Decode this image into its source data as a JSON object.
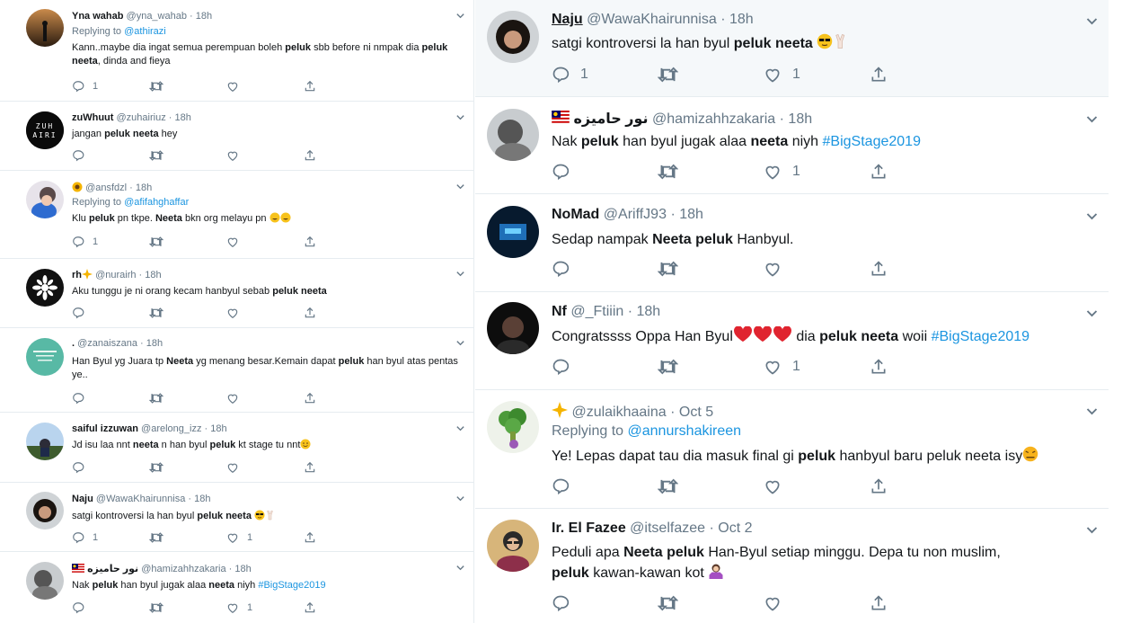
{
  "icons": {
    "reply": "reply-icon",
    "retweet": "retweet-icon",
    "like": "heart-icon",
    "share": "share-icon",
    "more": "chevron-down-icon"
  },
  "colors": {
    "text": "#14171a",
    "muted": "#657786",
    "link": "#1b95e0",
    "highlight": "#f5f8fa",
    "border": "#e6ecf0"
  },
  "left_panel": {
    "tweets": [
      {
        "name": "Yna wahab",
        "handle": "@yna_wahab",
        "sep": "·",
        "time": "18h",
        "replying_label": "Replying to",
        "replying_to": "@athirazi",
        "text": [
          {
            "t": "Kann..maybe dia ingat semua perempuan boleh "
          },
          {
            "t": "peluk",
            "b": true
          },
          {
            "t": " sbb before ni nmpak dia "
          },
          {
            "t": "peluk neeta",
            "b": true
          },
          {
            "t": ", dinda and fieya"
          }
        ],
        "counts": {
          "reply": "1",
          "retweet": "",
          "like": ""
        }
      },
      {
        "name": "zuWhuut",
        "handle": "@zuhairiuz",
        "sep": "·",
        "time": "18h",
        "avatar_text": "ZUH AIRI",
        "text": [
          {
            "t": "jangan "
          },
          {
            "t": "peluk neeta",
            "b": true
          },
          {
            "t": " hey"
          }
        ],
        "counts": {
          "reply": "",
          "retweet": "",
          "like": ""
        }
      },
      {
        "name": "",
        "handle": "@ansfdzl",
        "sep": "·",
        "time": "18h",
        "replying_label": "Replying to",
        "replying_to": "@afifahghaffar",
        "text": [
          {
            "t": "Klu "
          },
          {
            "t": "peluk",
            "b": true
          },
          {
            "t": " pn tkpe. "
          },
          {
            "t": "Neeta",
            "b": true
          },
          {
            "t": " bkn org melayu pn "
          }
        ],
        "counts": {
          "reply": "1",
          "retweet": "",
          "like": ""
        }
      },
      {
        "name": "rh",
        "handle": "@nurairh",
        "sep": "·",
        "time": "18h",
        "text": [
          {
            "t": "Aku tunggu je ni orang kecam hanbyul sebab "
          },
          {
            "t": "peluk neeta",
            "b": true
          }
        ],
        "counts": {
          "reply": "",
          "retweet": "",
          "like": ""
        }
      },
      {
        "name": ".",
        "handle": "@zanaiszana",
        "sep": "·",
        "time": "18h",
        "text": [
          {
            "t": "Han Byul yg Juara tp "
          },
          {
            "t": "Neeta",
            "b": true
          },
          {
            "t": " yg menang besar.Kemain dapat "
          },
          {
            "t": "peluk",
            "b": true
          },
          {
            "t": " han byul atas pentas ye.."
          }
        ],
        "counts": {
          "reply": "",
          "retweet": "",
          "like": ""
        }
      },
      {
        "name": "saiful izzuwan",
        "handle": "@arelong_izz",
        "sep": "·",
        "time": "18h",
        "text": [
          {
            "t": "Jd isu laa nnt "
          },
          {
            "t": "neeta",
            "b": true
          },
          {
            "t": " n han byul "
          },
          {
            "t": "peluk",
            "b": true
          },
          {
            "t": " kt stage tu nnt"
          }
        ],
        "counts": {
          "reply": "",
          "retweet": "",
          "like": ""
        }
      },
      {
        "name": "Naju",
        "handle": "@WawaKhairunnisa",
        "sep": "·",
        "time": "18h",
        "text": [
          {
            "t": "satgi kontroversi la han byul "
          },
          {
            "t": "peluk neeta",
            "b": true
          },
          {
            "t": " "
          }
        ],
        "counts": {
          "reply": "1",
          "retweet": "",
          "like": "1"
        }
      },
      {
        "name": "نور حامیزه",
        "handle": "@hamizahhzakaria",
        "sep": "·",
        "time": "18h",
        "text": [
          {
            "t": "Nak "
          },
          {
            "t": "peluk",
            "b": true
          },
          {
            "t": " han byul jugak alaa "
          },
          {
            "t": "neeta",
            "b": true
          },
          {
            "t": " niyh "
          },
          {
            "t": "#BigStage2019",
            "l": true
          }
        ],
        "counts": {
          "reply": "",
          "retweet": "",
          "like": "1"
        }
      }
    ]
  },
  "right_panel": {
    "tweets": [
      {
        "name": "Naju",
        "handle": "@WawaKhairunnisa",
        "sep": "·",
        "time": "18h",
        "text": [
          {
            "t": "satgi kontroversi la han byul "
          },
          {
            "t": "peluk neeta",
            "b": true
          },
          {
            "t": " "
          }
        ],
        "counts": {
          "reply": "1",
          "retweet": "",
          "like": "1"
        }
      },
      {
        "name": "نور حامیزه",
        "handle": "@hamizahhzakaria",
        "sep": "·",
        "time": "18h",
        "text": [
          {
            "t": "Nak "
          },
          {
            "t": "peluk",
            "b": true
          },
          {
            "t": " han byul jugak alaa "
          },
          {
            "t": "neeta",
            "b": true
          },
          {
            "t": " niyh "
          },
          {
            "t": "#BigStage2019",
            "l": true
          }
        ],
        "counts": {
          "reply": "",
          "retweet": "",
          "like": "1"
        }
      },
      {
        "name": "NoMad",
        "handle": "@AriffJ93",
        "sep": "·",
        "time": "18h",
        "text": [
          {
            "t": "Sedap nampak "
          },
          {
            "t": "Neeta peluk",
            "b": true
          },
          {
            "t": " Hanbyul."
          }
        ],
        "counts": {
          "reply": "",
          "retweet": "",
          "like": ""
        }
      },
      {
        "name": "Nf",
        "handle": "@_Ftiiin",
        "sep": "·",
        "time": "18h",
        "text": [
          {
            "t": "Congratssss Oppa Han Byul"
          },
          {
            "t": " dia "
          },
          {
            "t": "peluk neeta",
            "b": true
          },
          {
            "t": " woii "
          },
          {
            "t": "#BigStage2019",
            "l": true
          }
        ],
        "counts": {
          "reply": "",
          "retweet": "",
          "like": "1"
        }
      },
      {
        "name": "",
        "handle": "@zulaikhaaina",
        "sep": "·",
        "time": "Oct 5",
        "replying_label": "Replying to",
        "replying_to": "@annurshakireen",
        "text": [
          {
            "t": "Ye! Lepas dapat tau dia masuk final gi "
          },
          {
            "t": "peluk",
            "b": true
          },
          {
            "t": " hanbyul baru peluk neeta isy"
          }
        ],
        "counts": {
          "reply": "",
          "retweet": "",
          "like": ""
        }
      },
      {
        "name": "Ir. El Fazee",
        "handle": "@itselfazee",
        "sep": "·",
        "time": "Oct 2",
        "text": [
          {
            "t": "Peduli apa "
          },
          {
            "t": "Neeta peluk",
            "b": true
          },
          {
            "t": " Han-Byul setiap minggu. Depa tu non muslim, "
          },
          {
            "t": "peluk",
            "b": true
          },
          {
            "t": " kawan-kawan kot "
          }
        ],
        "counts": {
          "reply": "",
          "retweet": "",
          "like": ""
        }
      }
    ]
  }
}
